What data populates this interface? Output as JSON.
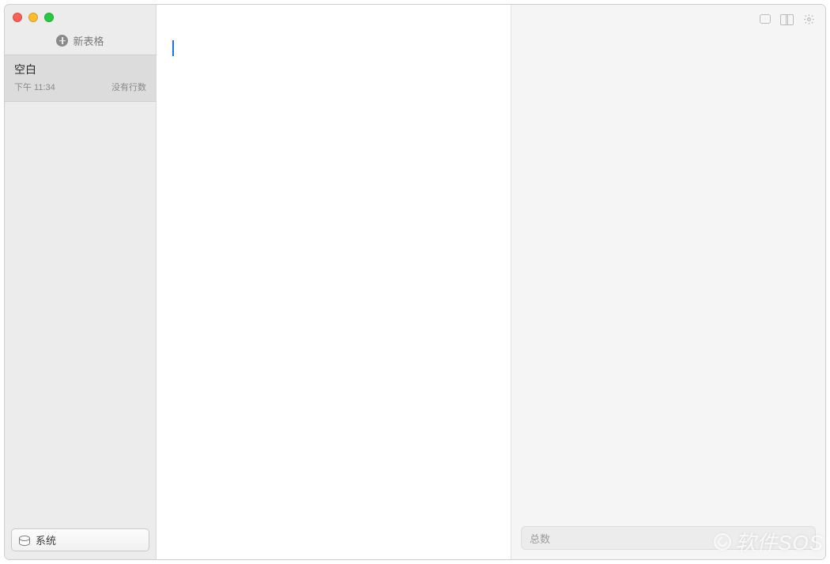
{
  "sidebar": {
    "new_sheet_label": "新表格",
    "items": [
      {
        "title": "空白",
        "time": "下午 11:34",
        "status": "没有行数"
      }
    ],
    "footer_button": "系统"
  },
  "right_panel": {
    "total_placeholder": "总数"
  },
  "watermark": {
    "text": "软件SOS"
  }
}
